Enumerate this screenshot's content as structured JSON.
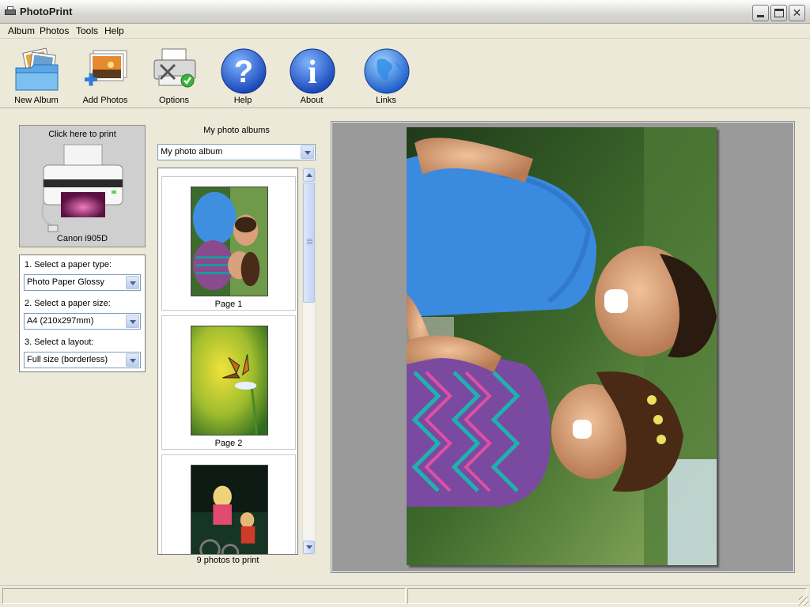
{
  "window": {
    "title": "PhotoPrint"
  },
  "menu": [
    "Album",
    "Photos",
    "Tools",
    "Help"
  ],
  "toolbar": [
    {
      "label": "New Album",
      "icon": "folder-photos-icon"
    },
    {
      "label": "Add Photos",
      "icon": "add-photos-icon"
    },
    {
      "label": "Options",
      "icon": "printer-options-icon"
    },
    {
      "label": "Help",
      "icon": "help-question-icon"
    },
    {
      "label": "About",
      "icon": "info-icon"
    },
    {
      "label": "Links",
      "icon": "globe-icon"
    }
  ],
  "printer": {
    "click_label": "Click here to print",
    "name": "Canon i905D"
  },
  "settings": {
    "paper_type_label": "1. Select a paper type:",
    "paper_type_value": "Photo Paper Glossy",
    "paper_size_label": "2. Select a paper size:",
    "paper_size_value": "A4 (210x297mm)",
    "layout_label": "3. Select a layout:",
    "layout_value": "Full size (borderless)"
  },
  "albums": {
    "title": "My photo albums",
    "selected": "My photo album",
    "pages": [
      {
        "label": "Page 1",
        "image": "couple-photo"
      },
      {
        "label": "Page 2",
        "image": "butterfly-photo"
      },
      {
        "label": "",
        "image": "children-bicycle-photo"
      }
    ],
    "count_text": "9 photos to print"
  },
  "colors": {
    "window_bg": "#ece9d8",
    "preview_bg": "#9a9a9a",
    "accent_blue": "#1f5fd6"
  }
}
